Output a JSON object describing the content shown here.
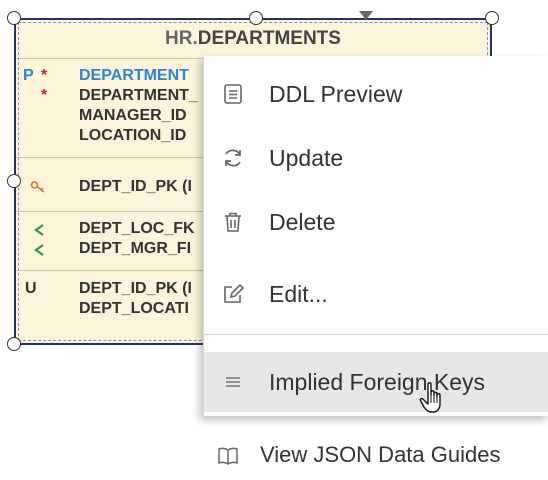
{
  "entity": {
    "schema": "HR.",
    "name": "DEPARTMENTS",
    "columns": [
      {
        "key": "P",
        "required": "*",
        "name": "DEPARTMENT"
      },
      {
        "key": "",
        "required": "*",
        "name": "DEPARTMENT_"
      },
      {
        "key": "",
        "required": "",
        "name": "MANAGER_ID"
      },
      {
        "key": "",
        "required": "",
        "name": "LOCATION_ID"
      }
    ],
    "primary_key": {
      "icon": "key-icon",
      "name": "DEPT_ID_PK (I"
    },
    "foreign_keys": [
      {
        "icon": "share-icon",
        "name": "DEPT_LOC_FK"
      },
      {
        "icon": "share-icon",
        "name": "DEPT_MGR_FI"
      }
    ],
    "unique_marker": "U",
    "unique_keys": [
      "DEPT_ID_PK (I",
      "DEPT_LOCATI"
    ]
  },
  "context_menu": {
    "items": [
      {
        "label": "DDL Preview",
        "icon": "document-icon"
      },
      {
        "label": "Update",
        "icon": "refresh-icon"
      },
      {
        "label": "Delete",
        "icon": "trash-icon"
      },
      {
        "label": "Edit...",
        "icon": "edit-icon"
      },
      {
        "label": "Implied Foreign Keys",
        "icon": "list-icon",
        "hovered": true
      },
      {
        "label": "View JSON Data Guides",
        "icon": "book-icon"
      }
    ]
  },
  "colors": {
    "entity_bg": "#fcf5dc",
    "entity_border": "#2a2f6e",
    "pk_blue": "#2f84d6",
    "required_red": "#d02020",
    "fk_green": "#1e9d55",
    "hover_bg": "#e7e7e7"
  }
}
